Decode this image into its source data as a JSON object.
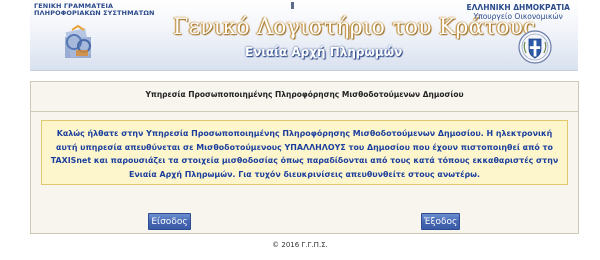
{
  "header": {
    "agency_line1": "ΓΕΝΙΚΗ ΓΡΑΜΜΑΤΕΙΑ",
    "agency_line2": "ΠΛΗΡΟΦΟΡΙΑΚΩΝ ΣΥΣΤΗΜΑΤΩΝ",
    "title": "Γενικό Λογιστήριο του Κράτους",
    "subtitle": "Ενιαία Αρχή Πληρωμών",
    "gov_line1": "ΕΛΛΗΝΙΚΗ ΔΗΜΟΚΡΑΤΙΑ",
    "gov_line2": "Υπουργείο Οικονομικών",
    "icons": [
      "gsis-logo-icon",
      "hellenic-republic-emblem-icon"
    ]
  },
  "panel": {
    "title": "Υπηρεσία Προσωποποιημένης Πληροφόρησης Μισθοδοτούμενων Δημοσίου",
    "notice": "Καλώς ήλθατε στην Υπηρεσία Προσωποποιημένης Πληροφόρησης Μισθοδοτούμενων Δημοσίου. Η ηλεκτρονική αυτή υπηρεσία απευθύνεται σε Μισθοδοτούμενους ΥΠΑΛΛΗΛΟΥΣ του Δημοσίου που έχουν πιστοποιηθεί από το TAXISnet και παρουσιάζει τα στοιχεία μισθοδοσίας όπως παραδίδονται από τους κατά τόπους εκκαθαριστές στην Ενιαία Αρχή Πληρωμών. Για τυχόν διευκρινίσεις απευθυνθείτε στους ανωτέρω.",
    "login_label": "Είσοδος",
    "logout_label": "Έξοδος"
  },
  "footer": {
    "copyright": "© 2016 Γ.Γ.Π.Σ."
  },
  "colors": {
    "notice_text": "#1c3f9e",
    "notice_bg": "#fdf6cc",
    "button_bg": "#4668b3",
    "title_glow": "#c98f2a"
  }
}
